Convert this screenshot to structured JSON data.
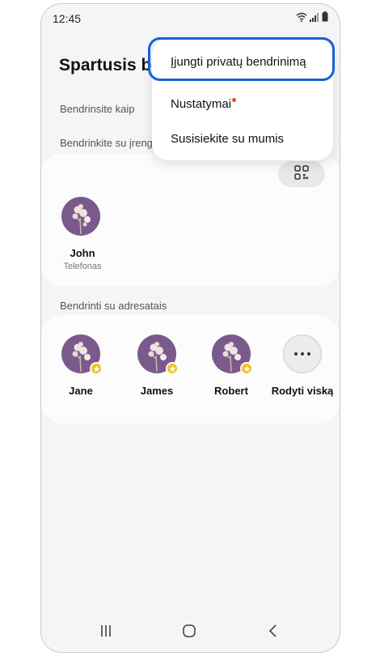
{
  "status_bar": {
    "time": "12:45",
    "icons": [
      "wifi-icon",
      "signal-icon",
      "battery-icon"
    ]
  },
  "header": {
    "title": "Spartusis bendrinimas"
  },
  "labels": {
    "share_as": "Bendrinsite kaip",
    "share_with_devices": "Bendrinkite su įrenginiais",
    "share_with_contacts": "Bendrinti su adresatais"
  },
  "devices": [
    {
      "name": "John",
      "type": "Telefonas"
    }
  ],
  "contacts": [
    {
      "name": "Jane",
      "favorite": true
    },
    {
      "name": "James",
      "favorite": true
    },
    {
      "name": "Robert",
      "favorite": true
    }
  ],
  "show_all": {
    "label": "Rodyti viską",
    "icon": "more-dots-icon"
  },
  "menu": {
    "items": [
      {
        "label": "Įjungti privatų bendrinimą",
        "highlighted": true
      },
      {
        "label": "Nustatymai",
        "has_notification_dot": true
      },
      {
        "label": "Susisiekite su mumis"
      }
    ]
  },
  "nav_bar": {
    "buttons": [
      "recents-icon",
      "home-icon",
      "back-icon"
    ]
  },
  "colors": {
    "highlight_border": "#1462d6",
    "notification_dot": "#e8541c",
    "favorite_star": "#f2c21b",
    "avatar_bg": "#7a5a8c"
  }
}
